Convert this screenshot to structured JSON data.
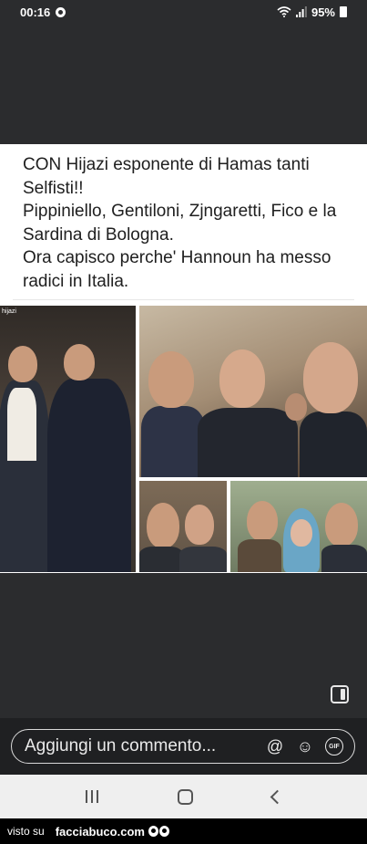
{
  "status_bar": {
    "time": "00:16",
    "battery": "95%"
  },
  "post": {
    "text": "CON Hijazi esponente di Hamas tanti Selfisti!!\nPippiniello, Gentiloni, Zjngaretti, Fico e la Sardina di Bologna.\nOra capisco perche' Hannoun ha messo radici in Italia.",
    "photo_label": "hijazi"
  },
  "comment_bar": {
    "placeholder": "Aggiungi un commento...",
    "gif_label": "GIF"
  },
  "footer": {
    "prefix": "visto su",
    "brand": "facciabuco.com"
  }
}
